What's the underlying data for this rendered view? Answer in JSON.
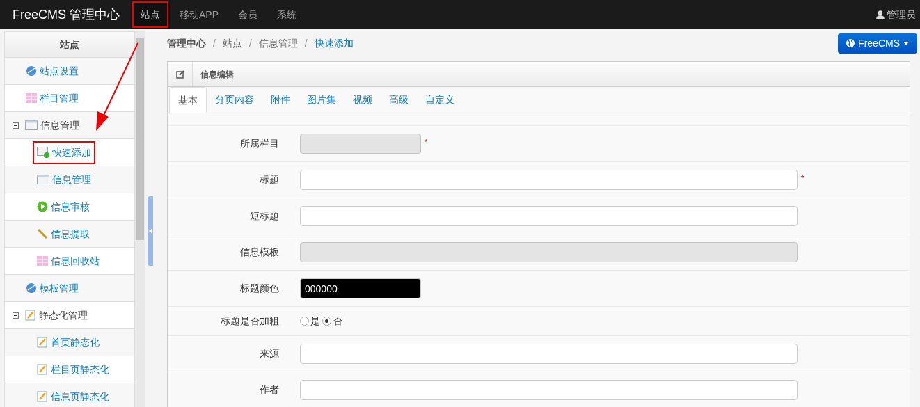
{
  "topbar": {
    "brand": "FreeCMS 管理中心",
    "nav": [
      {
        "label": "站点",
        "selected": true,
        "highlighted": true
      },
      {
        "label": "移动APP",
        "selected": false,
        "highlighted": false
      },
      {
        "label": "会员",
        "selected": false,
        "highlighted": false
      },
      {
        "label": "系统",
        "selected": false,
        "highlighted": false
      }
    ],
    "user": "管理员"
  },
  "sidebar": {
    "title": "站点",
    "items": [
      {
        "label": "站点设置",
        "highlighted": false
      },
      {
        "label": "栏目管理",
        "highlighted": false
      },
      {
        "label": "信息管理",
        "expanded": true,
        "highlighted": false,
        "children": [
          {
            "label": "快速添加",
            "highlighted": true
          },
          {
            "label": "信息管理",
            "highlighted": false
          },
          {
            "label": "信息审核",
            "highlighted": false
          },
          {
            "label": "信息提取",
            "highlighted": false
          },
          {
            "label": "信息回收站",
            "highlighted": false
          }
        ]
      },
      {
        "label": "模板管理",
        "highlighted": false
      },
      {
        "label": "静态化管理",
        "expanded": true,
        "highlighted": false,
        "children": [
          {
            "label": "首页静态化",
            "highlighted": false
          },
          {
            "label": "栏目页静态化",
            "highlighted": false
          },
          {
            "label": "信息页静态化",
            "highlighted": false
          }
        ]
      }
    ]
  },
  "breadcrumb": [
    "管理中心",
    "站点",
    "信息管理",
    "快速添加"
  ],
  "breadcrumb_separator": "/",
  "site_button": "FreeCMS",
  "panel": {
    "title": "信息编辑",
    "tabs": [
      {
        "label": "基本",
        "selected": true
      },
      {
        "label": "分页内容",
        "selected": false
      },
      {
        "label": "附件",
        "selected": false
      },
      {
        "label": "图片集",
        "selected": false
      },
      {
        "label": "视频",
        "selected": false
      },
      {
        "label": "高级",
        "selected": false
      },
      {
        "label": "自定义",
        "selected": false
      }
    ],
    "fields": [
      {
        "kind": "text",
        "label": "所属栏目",
        "wide": false,
        "disabled": true,
        "required": "*"
      },
      {
        "kind": "text",
        "label": "标题",
        "wide": true,
        "disabled": false,
        "required": "*"
      },
      {
        "kind": "text",
        "label": "短标题",
        "wide": true,
        "disabled": false
      },
      {
        "kind": "text",
        "label": "信息模板",
        "wide": true,
        "disabled": true
      },
      {
        "kind": "color",
        "label": "标题颜色",
        "value": "000000",
        "color": "#000000"
      },
      {
        "kind": "radio",
        "label": "标题是否加粗",
        "options": [
          {
            "label": "是",
            "selected": false
          },
          {
            "label": "否",
            "selected": true
          }
        ]
      },
      {
        "kind": "text",
        "label": "来源",
        "wide": true,
        "disabled": false
      },
      {
        "kind": "text",
        "label": "作者",
        "wide": true,
        "disabled": false
      }
    ]
  }
}
